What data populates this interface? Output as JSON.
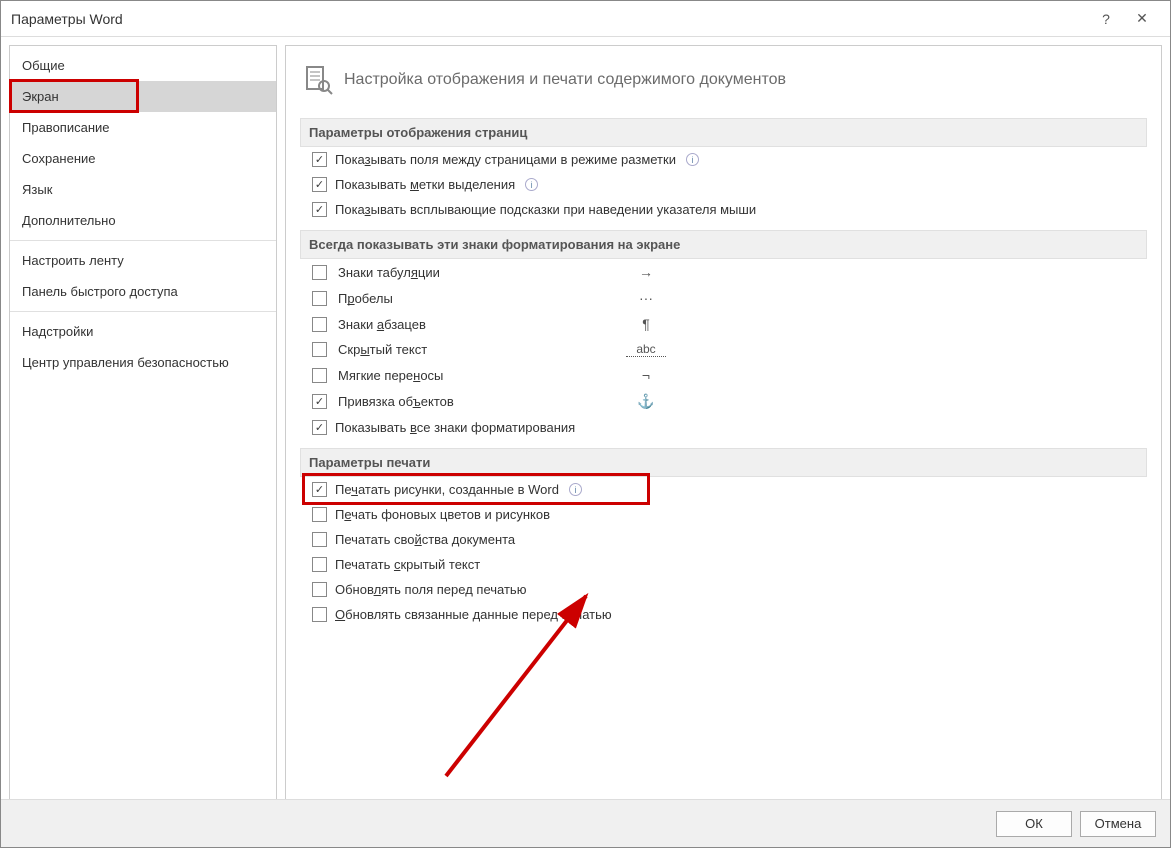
{
  "window": {
    "title": "Параметры Word",
    "help": "?",
    "close": "✕"
  },
  "sidebar": {
    "items": [
      {
        "label": "Общие"
      },
      {
        "label": "Экран",
        "selected": true
      },
      {
        "label": "Правописание"
      },
      {
        "label": "Сохранение"
      },
      {
        "label": "Язык"
      },
      {
        "label": "Дополнительно"
      }
    ],
    "items2": [
      {
        "label": "Настроить ленту"
      },
      {
        "label": "Панель быстрого доступа"
      }
    ],
    "items3": [
      {
        "label": "Надстройки"
      },
      {
        "label": "Центр управления безопасностью"
      }
    ]
  },
  "main": {
    "header": "Настройка отображения и печати содержимого документов",
    "section1": {
      "title": "Параметры отображения страниц",
      "opts": [
        {
          "label_pre": "Пока",
          "u": "з",
          "label_post": "ывать поля между страницами в режиме разметки",
          "checked": true,
          "info": true
        },
        {
          "label_pre": "Показывать ",
          "u": "м",
          "label_post": "етки выделения",
          "checked": true,
          "info": true
        },
        {
          "label_pre": "Пока",
          "u": "з",
          "label_post": "ывать всплывающие подсказки при наведении указателя мыши",
          "checked": true,
          "info": false
        }
      ]
    },
    "section2": {
      "title": "Всегда показывать эти знаки форматирования на экране",
      "opts": [
        {
          "label_pre": "Знаки табул",
          "u": "я",
          "label_post": "ции",
          "checked": false,
          "sym": "→"
        },
        {
          "label_pre": "П",
          "u": "р",
          "label_post": "обелы",
          "checked": false,
          "sym": "···"
        },
        {
          "label_pre": "Знаки ",
          "u": "а",
          "label_post": "бзацев",
          "checked": false,
          "sym": "¶"
        },
        {
          "label_pre": "Скр",
          "u": "ы",
          "label_post": "тый текст",
          "checked": false,
          "sym": "abc",
          "sym_dotted": true
        },
        {
          "label_pre": "Мягкие пере",
          "u": "н",
          "label_post": "осы",
          "checked": false,
          "sym": "¬"
        },
        {
          "label_pre": "Привязка об",
          "u": "ъ",
          "label_post": "ектов",
          "checked": true,
          "sym": "⚓"
        }
      ],
      "last": {
        "label_pre": "Показывать ",
        "u": "в",
        "label_post": "се знаки форматирования",
        "checked": true
      }
    },
    "section3": {
      "title": "Параметры печати",
      "opts": [
        {
          "label_pre": "Пе",
          "u": "ч",
          "label_post": "атать рисунки, созданные в Word",
          "checked": true,
          "info": true,
          "highlight": true
        },
        {
          "label_pre": "П",
          "u": "е",
          "label_post": "чать фоновых цветов и рисунков",
          "checked": false
        },
        {
          "label_pre": "Печатать сво",
          "u": "й",
          "label_post": "ства документа",
          "checked": false
        },
        {
          "label_pre": "Печатать ",
          "u": "с",
          "label_post": "крытый текст",
          "checked": false
        },
        {
          "label_pre": "Обнов",
          "u": "л",
          "label_post": "ять поля перед печатью",
          "checked": false
        },
        {
          "label_pre": "",
          "u": "О",
          "label_post": "бновлять связанные данные перед печатью",
          "checked": false
        }
      ]
    }
  },
  "footer": {
    "ok": "ОК",
    "cancel": "Отмена"
  }
}
